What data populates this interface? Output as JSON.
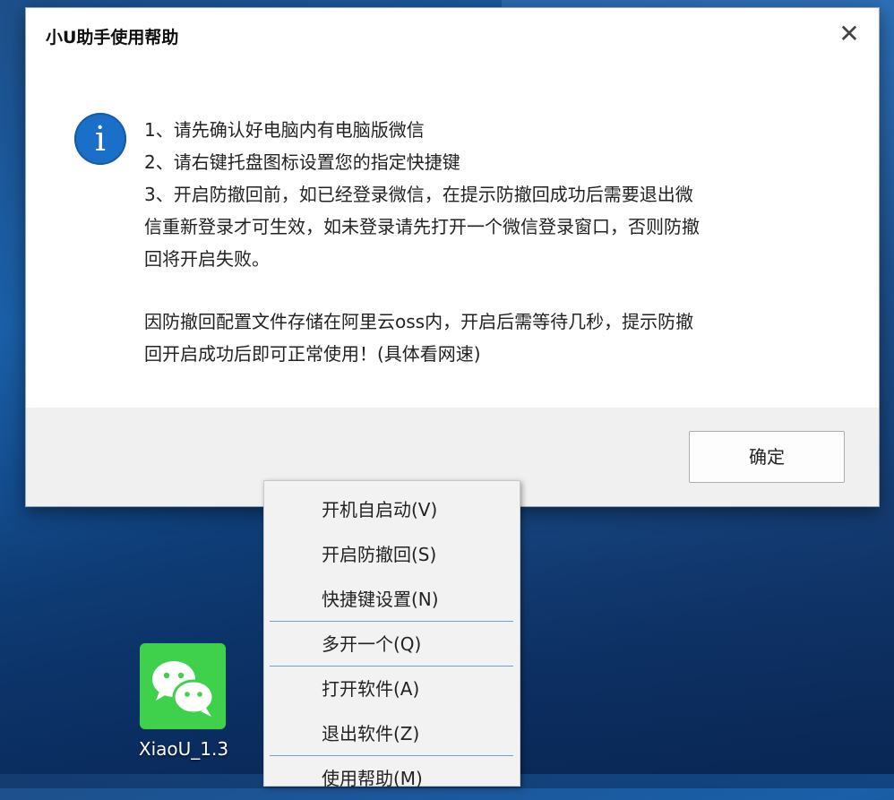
{
  "dialog": {
    "title": "小U助手使用帮助",
    "close_glyph": "✕",
    "info_glyph": "i",
    "lines": [
      "1、请先确认好电脑内有电脑版微信",
      "2、请右键托盘图标设置您的指定快捷键",
      "3、开启防撤回前，如已经登录微信，在提示防撤回成功后需要退出微",
      "信重新登录才可生效，如未登录请先打开一个微信登录窗口，否则防撤",
      "回将开启失败。"
    ],
    "note_lines": [
      "因防撤回配置文件存储在阿里云oss内，开启后需等待几秒，提示防撤",
      "回开启成功后即可正常使用！(具体看网速)"
    ],
    "ok_label": "确定"
  },
  "context_menu": {
    "items": [
      "开机自启动(V)",
      "开启防撤回(S)",
      "快捷键设置(N)",
      "多开一个(Q)",
      "打开软件(A)",
      "退出软件(Z)",
      "使用帮助(M)"
    ]
  },
  "desktop": {
    "icon_label": "XiaoU_1.3"
  },
  "colors": {
    "info_icon": "#1a6fc9",
    "wechat_green": "#3fd14b",
    "menu_separator": "#6aa0d8"
  }
}
